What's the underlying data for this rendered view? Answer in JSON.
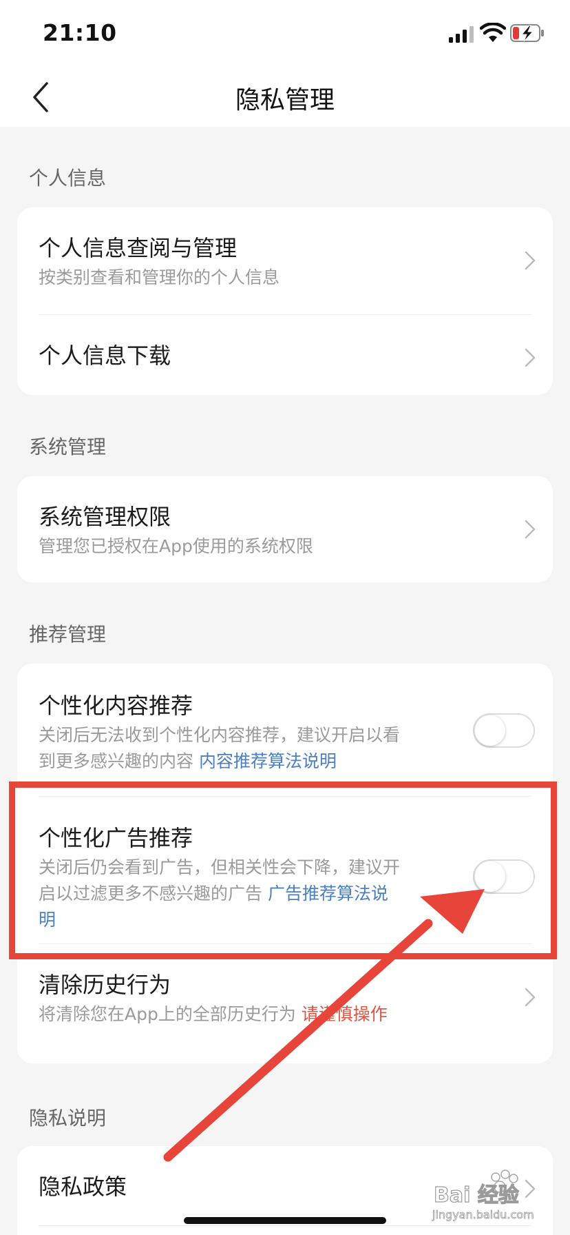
{
  "status_bar": {
    "time": "21:10"
  },
  "nav": {
    "title": "隐私管理"
  },
  "sections": {
    "personal": {
      "label": "个人信息",
      "view_manage": {
        "title": "个人信息查阅与管理",
        "subtitle": "按类别查看和管理你的个人信息"
      },
      "download": {
        "title": "个人信息下载"
      }
    },
    "system": {
      "label": "系统管理",
      "permissions": {
        "title": "系统管理权限",
        "subtitle": "管理您已授权在App使用的系统权限"
      }
    },
    "recommend": {
      "label": "推荐管理",
      "content": {
        "title": "个性化内容推荐",
        "subtitle_line1": "关闭后无法收到个性化内容推荐，建议开启以看",
        "subtitle_line2": "到更多感兴趣的内容",
        "link": "内容推荐算法说明",
        "enabled": false
      },
      "ads": {
        "title": "个性化广告推荐",
        "subtitle_line1": "关闭后仍会看到广告，但相关性会下降，建议开",
        "subtitle_line2": "启以过滤更多不感兴趣的广告",
        "link_line2": "广告推荐算法说",
        "link_line3": "明",
        "enabled": false
      },
      "clear_history": {
        "title": "清除历史行为",
        "subtitle": "将清除您在App上的全部历史行为",
        "warning": "请谨慎操作"
      }
    },
    "privacy": {
      "label": "隐私说明",
      "policy": {
        "title": "隐私政策"
      }
    }
  },
  "watermark": {
    "text": "Bai 经验",
    "url": "jingyan.baidu.com"
  },
  "colors": {
    "accent_link": "#4a7fc1",
    "warning": "#e05442",
    "annotation": "#e8453a",
    "background": "#f5f5f5"
  }
}
